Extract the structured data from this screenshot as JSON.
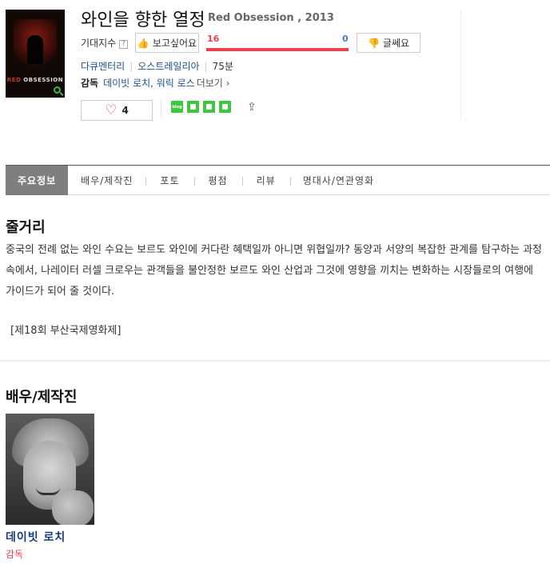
{
  "movie": {
    "title": "와인을 향한 열정",
    "original_title": "Red Obsession , 2013",
    "poster_text_red": "RED",
    "poster_text_white": " OBSESSION",
    "expectation_label": "기대지수",
    "help_glyph": "?",
    "want_label": "보고싶어요",
    "want_count": "16",
    "dont_label": "글쎄요",
    "dont_count": "0",
    "want_fraction": 1.0,
    "genre": "다큐멘터리",
    "country": "오스트레일리아",
    "runtime": "75분",
    "director_label": "감독",
    "directors": "데이빗 로치, 워릭 로스",
    "more_label": "더보기 ›",
    "like_count": "4",
    "share_icons": [
      "blog-icon",
      "cafe-icon",
      "bookmark-icon",
      "memo-icon"
    ],
    "accent_red": "#e8414f",
    "accent_blue": "#4a7ccd"
  },
  "tabs": [
    {
      "label": "주요정보",
      "active": true
    },
    {
      "label": "배우/제작진"
    },
    {
      "label": "포토"
    },
    {
      "label": "평점"
    },
    {
      "label": "리뷰"
    },
    {
      "label": "명대사/연관영화"
    }
  ],
  "synopsis": {
    "heading": "줄거리",
    "text": "중국의 전례 없는 와인 수요는 보르도 와인에 커다란 혜택일까 아니면 위협일까? 동양과 서양의 복잡한 관계를 탐구하는 과정 속에서, 나레이터 러셀 크로우는 관객들을 불안정한 보르도 와인 산업과 그것에 영향을 끼치는 변화하는 시장들로의 여행에 가이드가 되어 줄 것이다.",
    "festival": "[제18회 부산국제영화제]"
  },
  "cast": {
    "heading": "배우/제작진",
    "people": [
      {
        "name": "데이빗 로치",
        "role": "감독"
      }
    ]
  }
}
